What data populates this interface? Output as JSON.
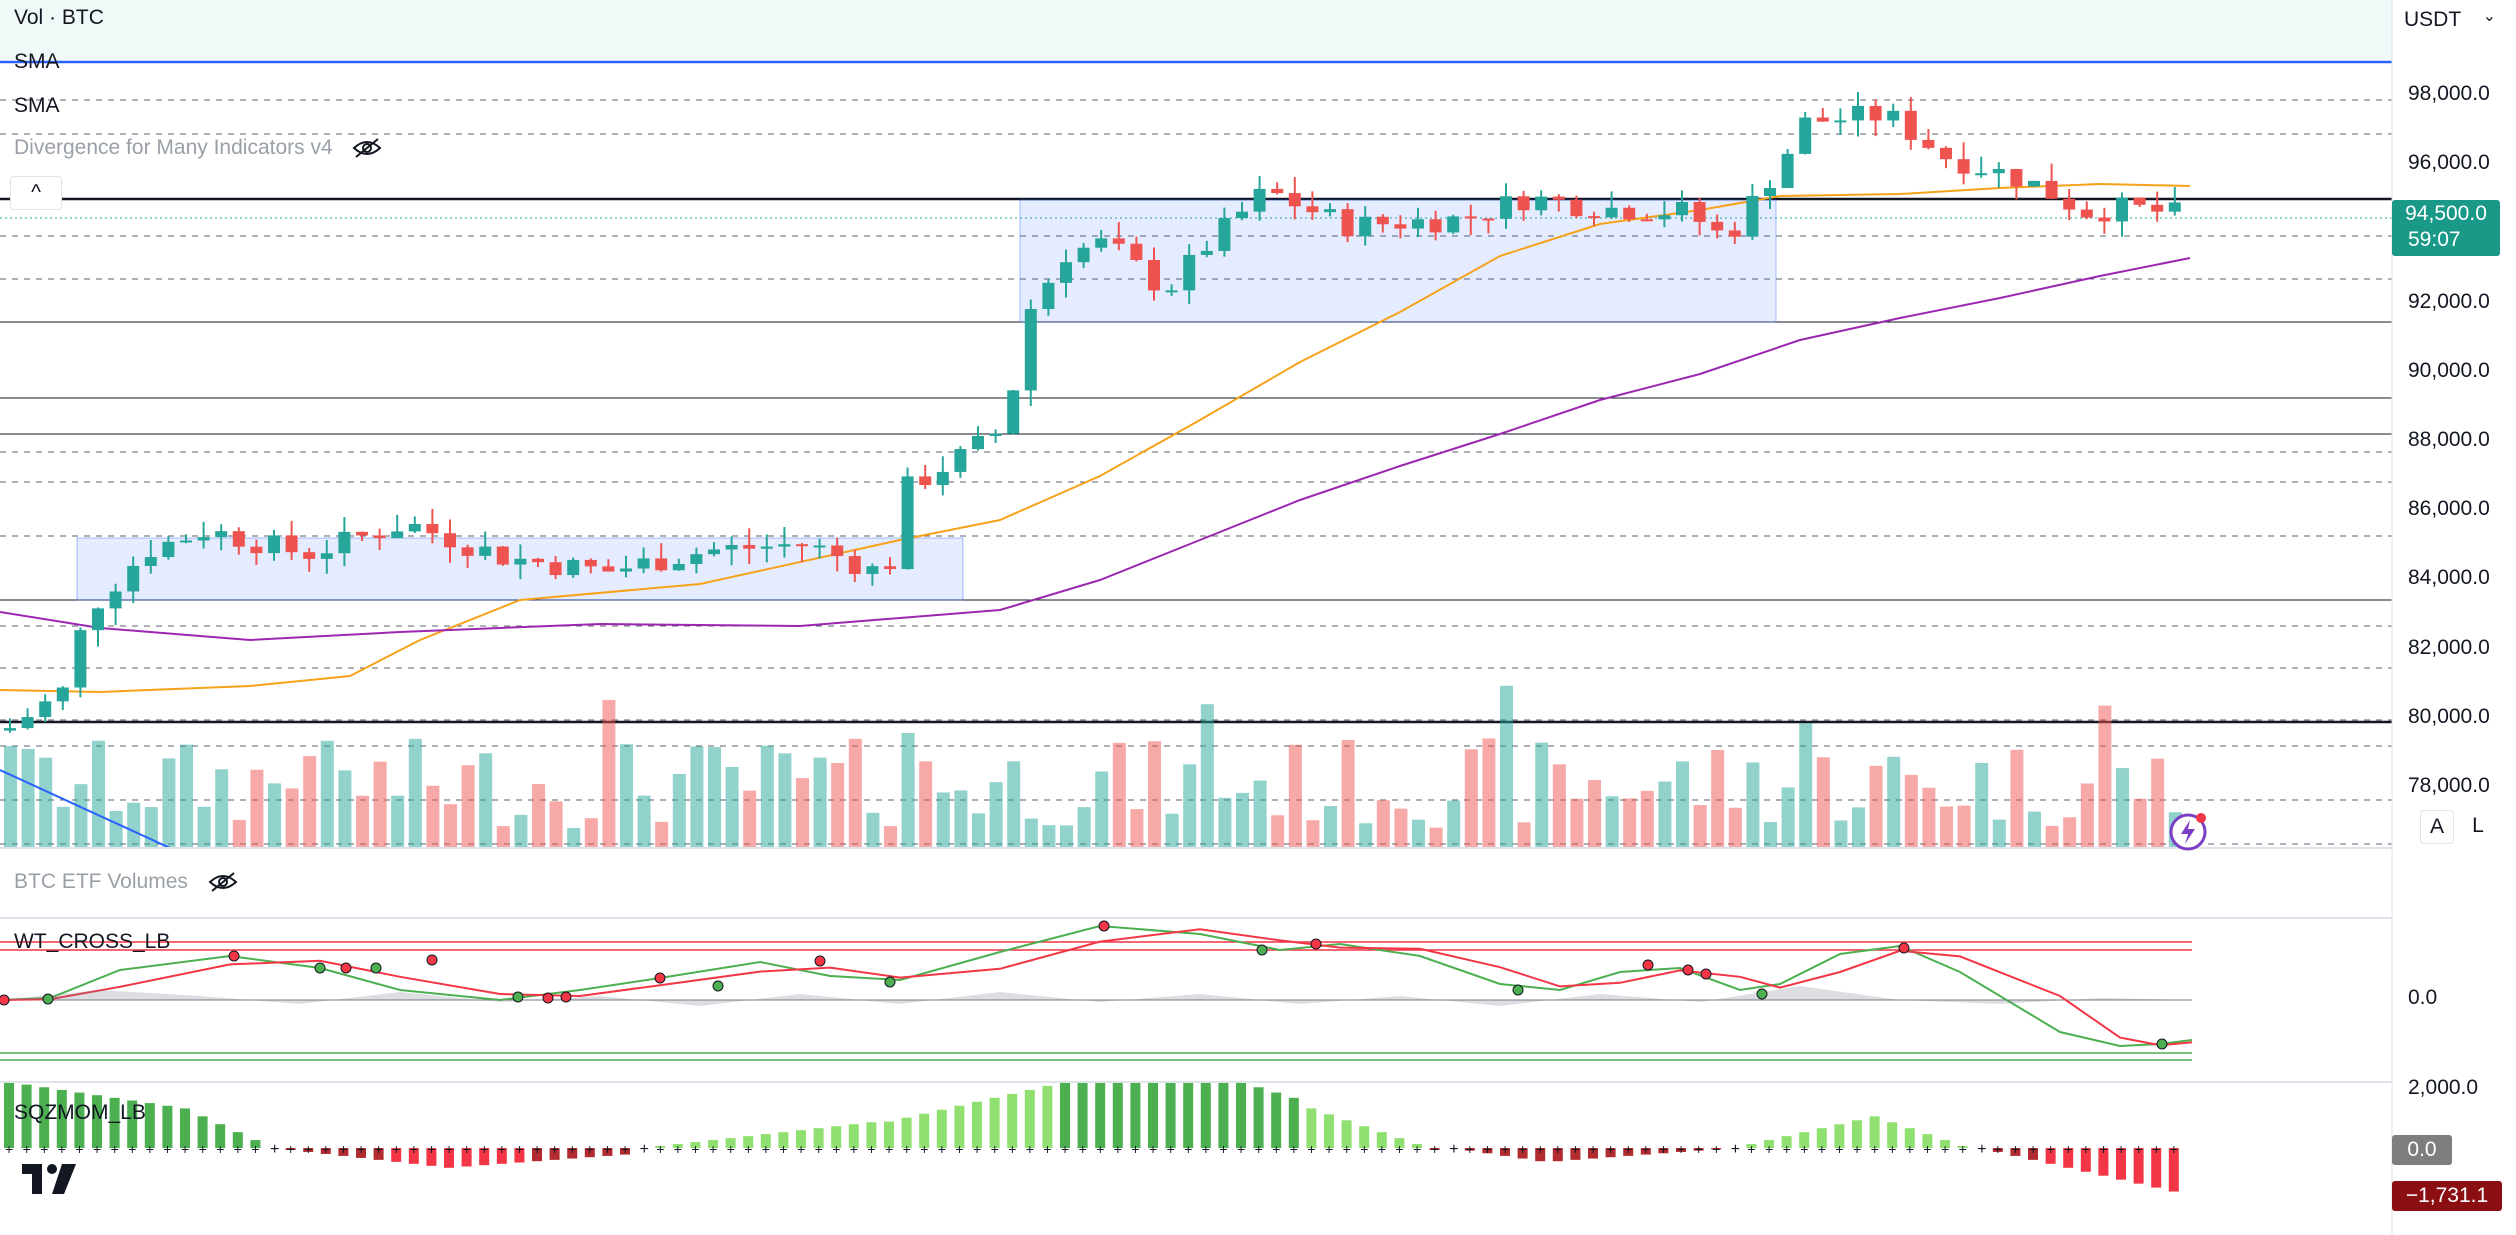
{
  "header": {
    "pair_label": "Vol · BTC",
    "currency": "USDT"
  },
  "indicators": {
    "sma1": "SMA",
    "sma2": "SMA",
    "divergence": "Divergence for Many Indicators v4",
    "etf_volumes": "BTC ETF Volumes",
    "wt_cross": "WT_CROSS_LB",
    "sqzmom": "SQZMOM_LB"
  },
  "price_axis": {
    "labels": [
      "98,000.0",
      "96,000.0",
      "92,000.0",
      "90,000.0",
      "88,000.0",
      "86,000.0",
      "84,000.0",
      "82,000.0",
      "80,000.0",
      "78,000.0"
    ],
    "current_price": "94,500.0",
    "countdown": "59:07",
    "current_color": "#1a9988"
  },
  "wt_axis": {
    "zero": "0.0"
  },
  "sqz_axis": {
    "top": "2,000.0",
    "zero": "0.0",
    "current": "−1,731.1"
  },
  "buttons": {
    "auto": "A",
    "log": "L",
    "collapse": "^"
  },
  "colors": {
    "up": "#26a69a",
    "down": "#ef5350",
    "sma_orange": "#f7a21b",
    "sma_purple": "#9c27b0",
    "sma_blue": "#2962ff"
  }
}
